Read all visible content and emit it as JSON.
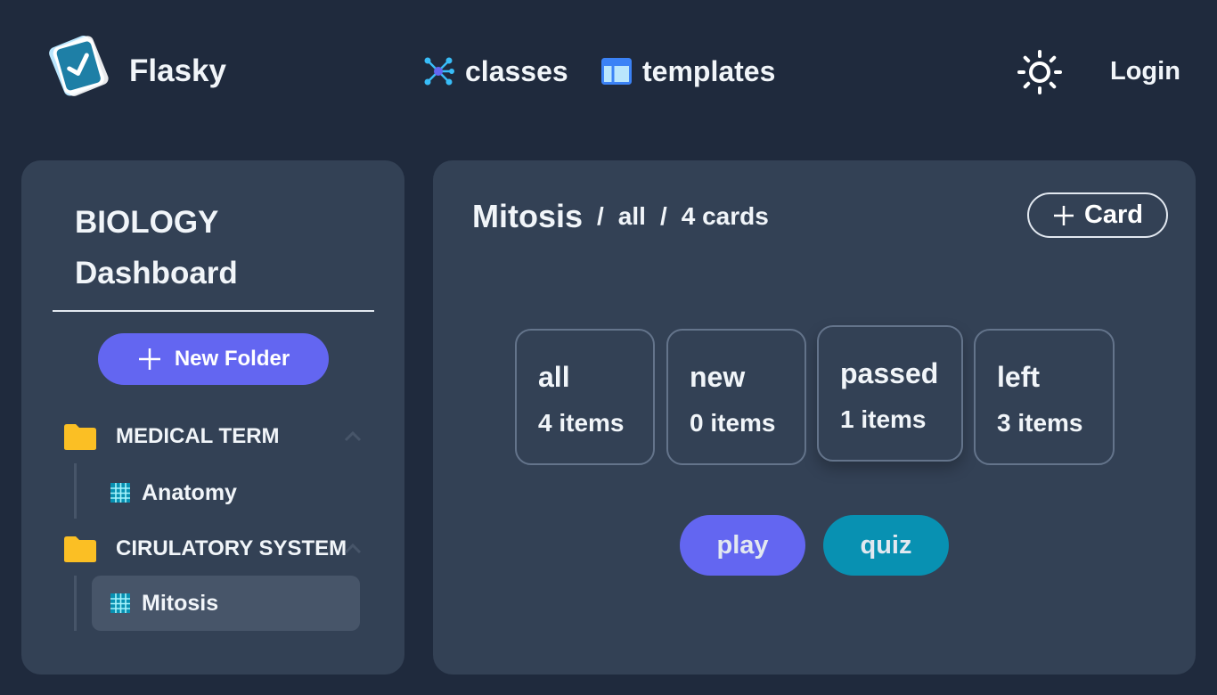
{
  "header": {
    "brand": "Flasky",
    "nav": [
      {
        "label": "classes",
        "icon": "network-icon"
      },
      {
        "label": "templates",
        "icon": "layout-icon"
      }
    ],
    "theme_icon": "sun-icon",
    "login_label": "Login"
  },
  "sidebar": {
    "title": "BIOLOGY",
    "subtitle": "Dashboard",
    "new_folder_label": "New Folder",
    "folders": [
      {
        "name": "MEDICAL TERM",
        "expanded": true,
        "decks": [
          {
            "name": "Anatomy",
            "active": false
          }
        ]
      },
      {
        "name": "CIRULATORY SYSTEM",
        "expanded": true,
        "decks": [
          {
            "name": "Mitosis",
            "active": true
          }
        ]
      }
    ]
  },
  "main": {
    "breadcrumb": {
      "deck": "Mitosis",
      "separator": "/",
      "filter": "all",
      "count": "4 cards"
    },
    "add_card_label": "Card",
    "stats": [
      {
        "label": "all",
        "count": "4 items"
      },
      {
        "label": "new",
        "count": "0 items"
      },
      {
        "label": "passed",
        "count": "1 items"
      },
      {
        "label": "left",
        "count": "3 items"
      }
    ],
    "play_label": "play",
    "quiz_label": "quiz"
  },
  "colors": {
    "background": "#1f2a3d",
    "panel": "#334155",
    "accent": "#6366f1",
    "quiz": "#0891b2",
    "folder": "#fbbf24"
  }
}
